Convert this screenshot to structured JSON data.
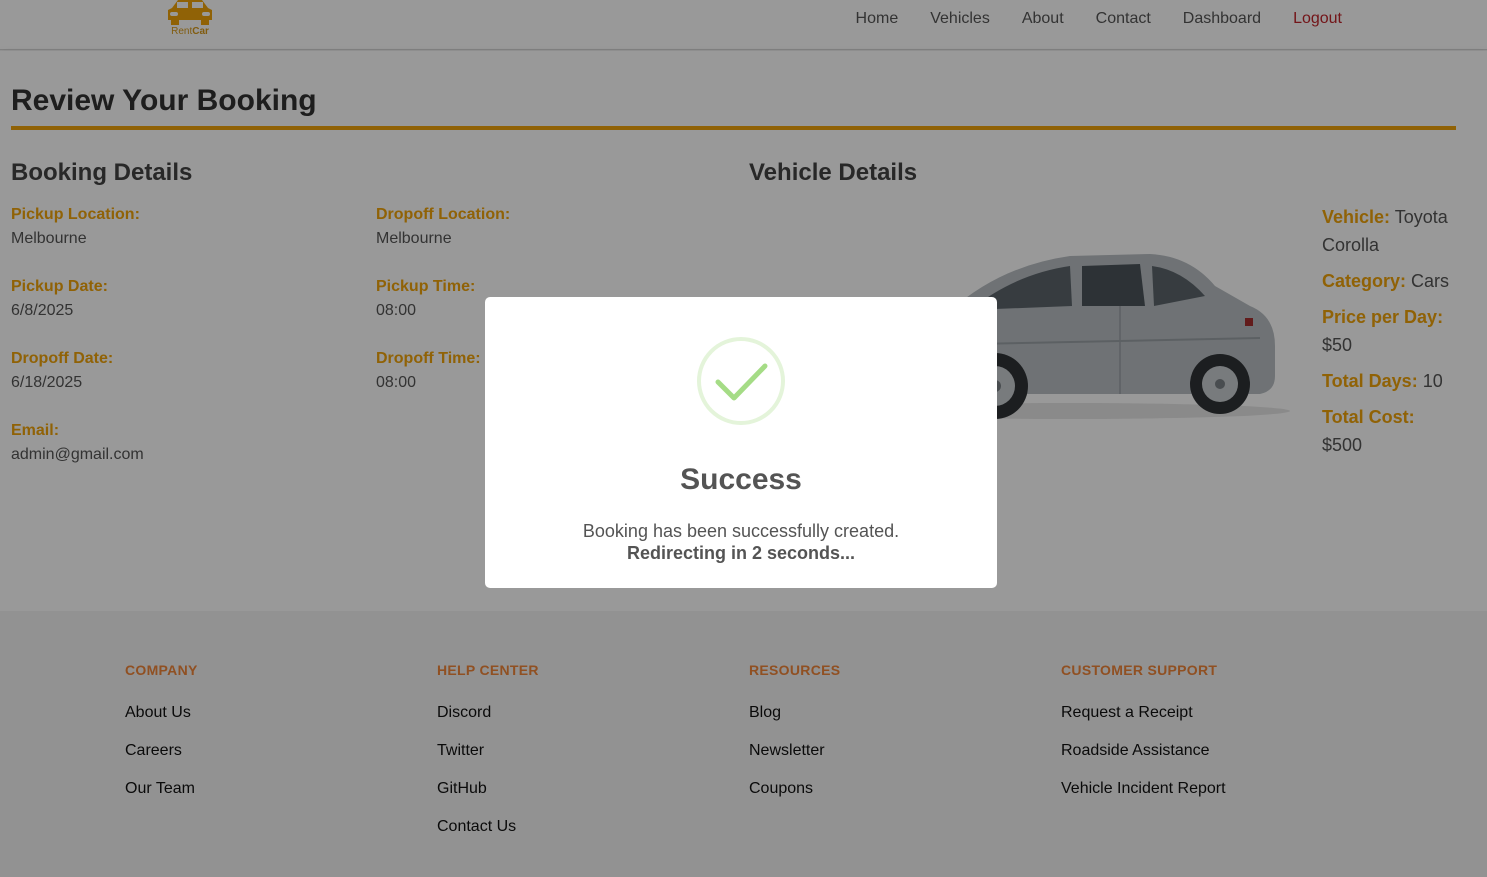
{
  "nav": {
    "logo_rent": "Rent",
    "logo_car": "Car",
    "items": [
      "Home",
      "Vehicles",
      "About",
      "Contact",
      "Dashboard"
    ],
    "logout": "Logout"
  },
  "page": {
    "title": "Review Your Booking"
  },
  "booking": {
    "heading": "Booking Details",
    "pickup_location_label": "Pickup Location:",
    "pickup_location": "Melbourne",
    "dropoff_location_label": "Dropoff Location:",
    "dropoff_location": "Melbourne",
    "pickup_date_label": "Pickup Date:",
    "pickup_date": "6/8/2025",
    "pickup_time_label": "Pickup Time:",
    "pickup_time": "08:00",
    "dropoff_date_label": "Dropoff Date:",
    "dropoff_date": "6/18/2025",
    "dropoff_time_label": "Dropoff Time:",
    "dropoff_time": "08:00",
    "email_label": "Email:",
    "email": "admin@gmail.com"
  },
  "vehicle": {
    "heading": "Vehicle Details",
    "vehicle_label": "Vehicle:",
    "vehicle": "Toyota Corolla",
    "category_label": "Category:",
    "category": "Cars",
    "price_label": "Price per Day:",
    "price": "$50",
    "days_label": "Total Days:",
    "days": "10",
    "cost_label": "Total Cost:",
    "cost": "$500"
  },
  "footer": {
    "company": {
      "heading": "COMPANY",
      "links": [
        "About Us",
        "Careers",
        "Our Team"
      ]
    },
    "help": {
      "heading": "HELP CENTER",
      "links": [
        "Discord",
        "Twitter",
        "GitHub",
        "Contact Us"
      ]
    },
    "resources": {
      "heading": "RESOURCES",
      "links": [
        "Blog",
        "Newsletter",
        "Coupons"
      ]
    },
    "support": {
      "heading": "CUSTOMER SUPPORT",
      "links": [
        "Request a Receipt",
        "Roadside Assistance",
        "Vehicle Incident Report"
      ]
    }
  },
  "modal": {
    "icon": "success-check-icon",
    "title": "Success",
    "message": "Booking has been successfully created.",
    "redirect": "Redirecting in 2 seconds..."
  },
  "colors": {
    "accent": "#f0a30a",
    "logout": "#c0242a",
    "footer_heading": "#f0853a",
    "success": "#a5dc86"
  }
}
